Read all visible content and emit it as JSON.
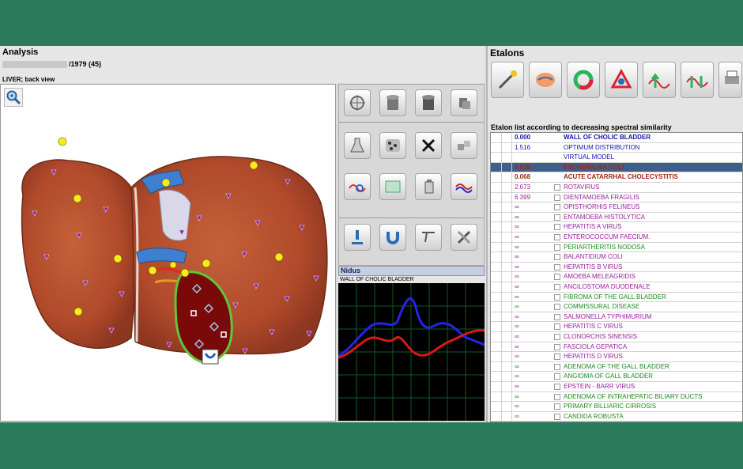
{
  "analysis": {
    "title": "Analysis",
    "patient_year": "/1979 (45)",
    "view_label": "LIVER; back view"
  },
  "nidus": {
    "title": "Nidus",
    "subtitle": "WALL OF CHOLIC BLADDER"
  },
  "etalons": {
    "title": "Etalons",
    "list_caption": "Etalon list according to decreasing spectral similarity",
    "colors": {
      "blue": "#1515a8",
      "brown": "#a02818",
      "purple": "#9a1e9a",
      "green": "#1e8a1e",
      "selected_bg": "#3e5e8c"
    },
    "rows": [
      {
        "value": "0.000",
        "name": "WALL OF CHOLIC BLADDER",
        "color": "#1515a8",
        "bold": true
      },
      {
        "value": "1.516",
        "name": "OPTIMUM DISTRIBUTION",
        "color": "#1515a8",
        "bold": false
      },
      {
        "value": "",
        "name": "VIRTUAL MODEL",
        "color": "#1515a8",
        "bold": false
      },
      {
        "value": "0.026",
        "name": "ESCHERICHIA  COLI",
        "color": "#a02818",
        "bold": true,
        "selected": true
      },
      {
        "value": "0.068",
        "name": "ACUTE  CATARRHAL  CHOLECYSTITIS",
        "color": "#a02818",
        "bold": true
      },
      {
        "value": "2.673",
        "name": "ROTAVIRUS",
        "color": "#9a1e9a",
        "bold": false
      },
      {
        "value": "6.399",
        "name": "DIENTAMOEBA FRAGILIS",
        "color": "#9a1e9a",
        "bold": false
      },
      {
        "value": "∞",
        "name": "OPISTHORHIS  FELINEUS",
        "color": "#9a1e9a",
        "bold": false
      },
      {
        "value": "∞",
        "name": "ENTAMOEBA HISTOLYTICA",
        "color": "#9a1e9a",
        "bold": false
      },
      {
        "value": "∞",
        "name": "HEPATITIS A VIRUS",
        "color": "#9a1e9a",
        "bold": false
      },
      {
        "value": "∞",
        "name": "ENTEROCOCCUM  FAECIUM.",
        "color": "#9a1e9a",
        "bold": false
      },
      {
        "value": "∞",
        "name": "PERIARTHERITIS  NODOSA",
        "color": "#1e8a1e",
        "bold": false
      },
      {
        "value": "∞",
        "name": "BALANTIDIUM COLI",
        "color": "#9a1e9a",
        "bold": false
      },
      {
        "value": "∞",
        "name": "HEPATITIS B VIRUS",
        "color": "#9a1e9a",
        "bold": false
      },
      {
        "value": "∞",
        "name": "AMOEBA MELEAGRIDIS",
        "color": "#9a1e9a",
        "bold": false
      },
      {
        "value": "∞",
        "name": "ANCILOSTOMA  DUODENALE",
        "color": "#9a1e9a",
        "bold": false
      },
      {
        "value": "∞",
        "name": "FIBROMA  OF THE GALL BLADDER",
        "color": "#1e8a1e",
        "bold": false
      },
      {
        "value": "∞",
        "name": "COMMISSURAL  DISEASE",
        "color": "#1e8a1e",
        "bold": false
      },
      {
        "value": "∞",
        "name": "SALMONELLA TYPHIMURIUM",
        "color": "#9a1e9a",
        "bold": false
      },
      {
        "value": "∞",
        "name": "HEPATITIS C VIRUS",
        "color": "#9a1e9a",
        "bold": false
      },
      {
        "value": "∞",
        "name": "CLONORCHIS SINENSIS",
        "color": "#9a1e9a",
        "bold": false
      },
      {
        "value": "∞",
        "name": "FASCIOLA  GEPATICA",
        "color": "#9a1e9a",
        "bold": false
      },
      {
        "value": "∞",
        "name": "HEPATITIS D VIRUS",
        "color": "#9a1e9a",
        "bold": false
      },
      {
        "value": "∞",
        "name": "ADENOMA  OF  THE  GALL  BLADDER",
        "color": "#1e8a1e",
        "bold": false
      },
      {
        "value": "∞",
        "name": "ANGIOMA OF  GALL BLADDER",
        "color": "#1e8a1e",
        "bold": false
      },
      {
        "value": "∞",
        "name": "EPSTEIN - BARR VIRUS",
        "color": "#9a1e9a",
        "bold": false
      },
      {
        "value": "∞",
        "name": "ADENOMA  OF  INTRAHEPATIC  BILIARY  DUCTS",
        "color": "#1e8a1e",
        "bold": false
      },
      {
        "value": "∞",
        "name": "PRIMARY  BILLIARIC  CIRROSIS",
        "color": "#1e8a1e",
        "bold": false
      },
      {
        "value": "∞",
        "name": "CANDIDA ROBUSTA",
        "color": "#1e8a1e",
        "bold": false
      }
    ]
  }
}
